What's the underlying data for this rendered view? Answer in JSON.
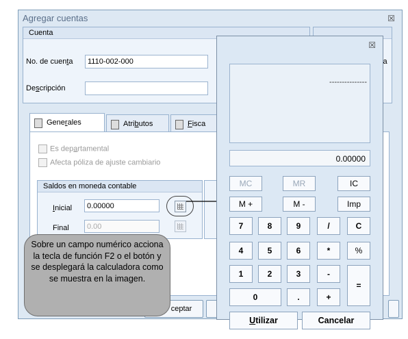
{
  "dialog": {
    "title": "Agregar cuentas",
    "close_symbol": "☒"
  },
  "cuenta_group": {
    "header": "Cuenta",
    "account_label_pre": "No. de cuen",
    "account_label_ul": "t",
    "account_label_post": "a",
    "account_value": "1110-002-000",
    "desc_label_pre": "De",
    "desc_label_ul": "s",
    "desc_label_post": "cripción",
    "desc_value": "",
    "partial_right_text": "va"
  },
  "tabs": [
    {
      "pre": "Gene",
      "ul": "r",
      "post": "ales"
    },
    {
      "pre": "Atri",
      "ul": "b",
      "post": "utos"
    },
    {
      "pre": "",
      "ul": "F",
      "post": "isca"
    }
  ],
  "generales": {
    "chk_departamental_pre": "Es dep",
    "chk_departamental_ul": "a",
    "chk_departamental_post": "rtamental",
    "chk_poliza": "Afecta póliza de ajuste cambiario",
    "saldos_header": "Saldos en moneda contable",
    "inicial_label_ul": "I",
    "inicial_label_post": "nicial",
    "inicial_value": "0.00000",
    "final_label": "Final",
    "final_value": "0.00"
  },
  "footer": {
    "aceptar_partial": "ceptar"
  },
  "calculator": {
    "close_symbol": "☒",
    "memory_display": "---------------",
    "value_display": "0.00000",
    "row1": [
      "MC",
      "MR",
      "IC"
    ],
    "row2": [
      "M +",
      "M -",
      "Imp"
    ],
    "keys": [
      [
        "7",
        "8",
        "9",
        "/",
        "C"
      ],
      [
        "4",
        "5",
        "6",
        "*",
        "%"
      ],
      [
        "1",
        "2",
        "3",
        "-",
        "="
      ],
      [
        "0",
        ".",
        "+"
      ]
    ],
    "utilizar_ul": "U",
    "utilizar_post": "tilizar",
    "cancelar": "Cancelar"
  },
  "callout": {
    "text": "Sobre un campo numérico acciona la tecla de función F2 o el botón  y se desplegará la calculadora como se muestra en la imagen."
  }
}
